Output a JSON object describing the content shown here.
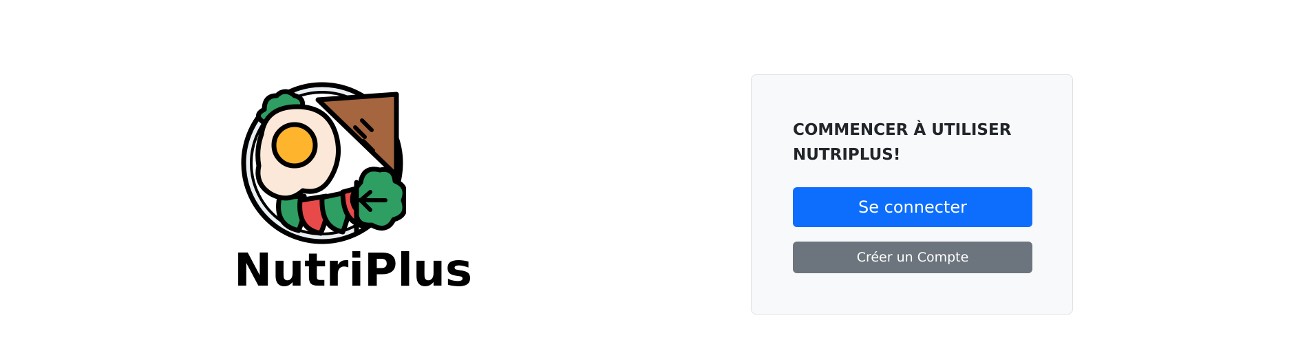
{
  "brand": {
    "name": "NutriPlus",
    "logo_icon": "food-plate-icon"
  },
  "card": {
    "title": "COMMENCER À UTILISER NUTRIPLUS!",
    "login_label": "Se connecter",
    "signup_label": "Créer un Compte"
  },
  "colors": {
    "primary": "#0d6efd",
    "secondary": "#6c757d",
    "card_background": "#f8f9fa",
    "card_border": "#dee2e6",
    "text_dark": "#212529"
  }
}
